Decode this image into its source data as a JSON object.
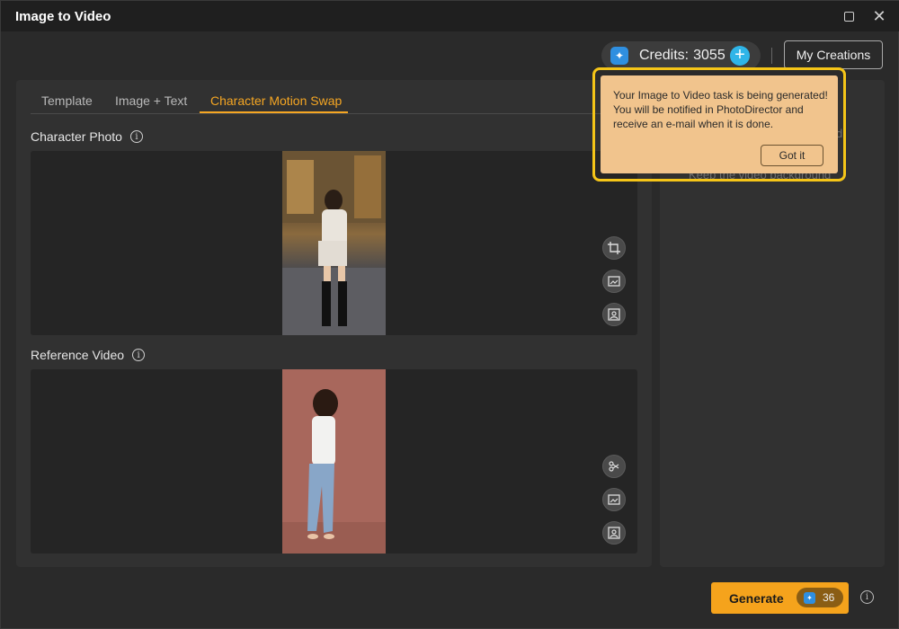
{
  "window": {
    "title": "Image to Video"
  },
  "header": {
    "credits_label": "Credits:",
    "credits_value": "3055",
    "my_creations_label": "My Creations"
  },
  "tabs": [
    {
      "label": "Template",
      "active": false
    },
    {
      "label": "Image + Text",
      "active": false
    },
    {
      "label": "Character Motion Swap",
      "active": true
    }
  ],
  "sections": {
    "character_photo_label": "Character Photo",
    "reference_video_label": "Reference Video"
  },
  "right_panel": {
    "partial_text_1": "d",
    "partial_text_2": "Keep the video background"
  },
  "tooltip": {
    "message": "Your Image to Video task is being generated! You will be notified in PhotoDirector and receive an e-mail when it is done.",
    "button_label": "Got it"
  },
  "footer": {
    "generate_label": "Generate",
    "generate_cost": "36"
  },
  "icons": {
    "credit": "sparkle-shield-icon",
    "add_credits": "plus-icon",
    "photo_tools": [
      "crop-icon",
      "replace-image-icon",
      "portrait-icon"
    ],
    "video_tools": [
      "trim-icon",
      "replace-image-icon",
      "portrait-icon"
    ]
  },
  "colors": {
    "accent": "#f5a623",
    "generate_button": "#f5a31c",
    "tooltip_bg": "#f1c48d",
    "tooltip_highlight": "#f5c518",
    "credit_plus": "#2fb5e8"
  }
}
